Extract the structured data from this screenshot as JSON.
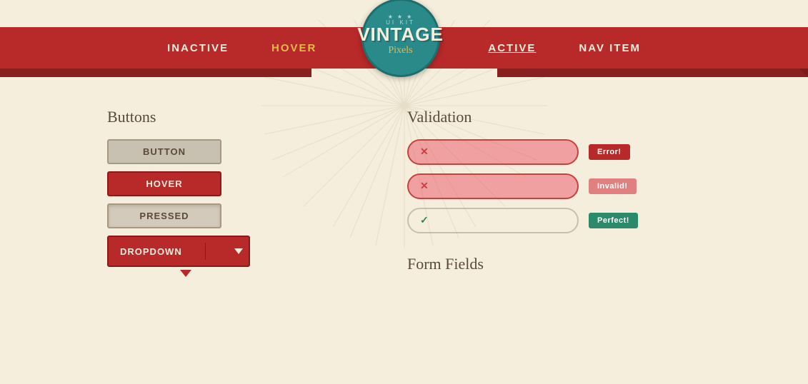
{
  "page": {
    "background_color": "#f5eedc"
  },
  "navbar": {
    "background_color": "#b8292a",
    "items": [
      {
        "id": "inactive",
        "label": "INACTIVE",
        "state": "default"
      },
      {
        "id": "hover",
        "label": "HOVER",
        "state": "hover"
      },
      {
        "id": "active",
        "label": "ACTIVE",
        "state": "active"
      },
      {
        "id": "nav-item",
        "label": "NAV ITEM",
        "state": "default"
      }
    ]
  },
  "logo": {
    "kit_label": "UI Kit",
    "brand_name": "VINTAGE",
    "sub_name": "Pixels",
    "star_row": "★ ★ ★"
  },
  "buttons_section": {
    "title": "Buttons",
    "items": [
      {
        "id": "btn-default",
        "label": "Button",
        "state": "default"
      },
      {
        "id": "btn-hover",
        "label": "Hover",
        "state": "hover"
      },
      {
        "id": "btn-pressed",
        "label": "Pressed",
        "state": "pressed"
      },
      {
        "id": "btn-dropdown",
        "label": "Dropdown",
        "state": "dropdown"
      }
    ],
    "dropdown_caret_label": "▼"
  },
  "validation_section": {
    "title": "Validation",
    "fields": [
      {
        "id": "field-error",
        "state": "error",
        "icon": "✕",
        "badge_label": "Error!",
        "badge_state": "error"
      },
      {
        "id": "field-invalid",
        "state": "invalid",
        "icon": "✕",
        "badge_label": "Invalid!",
        "badge_state": "invalid"
      },
      {
        "id": "field-valid",
        "state": "valid",
        "icon": "✓",
        "badge_label": "Perfect!",
        "badge_state": "perfect"
      }
    ]
  },
  "form_fields_section": {
    "title": "Form Fields"
  }
}
